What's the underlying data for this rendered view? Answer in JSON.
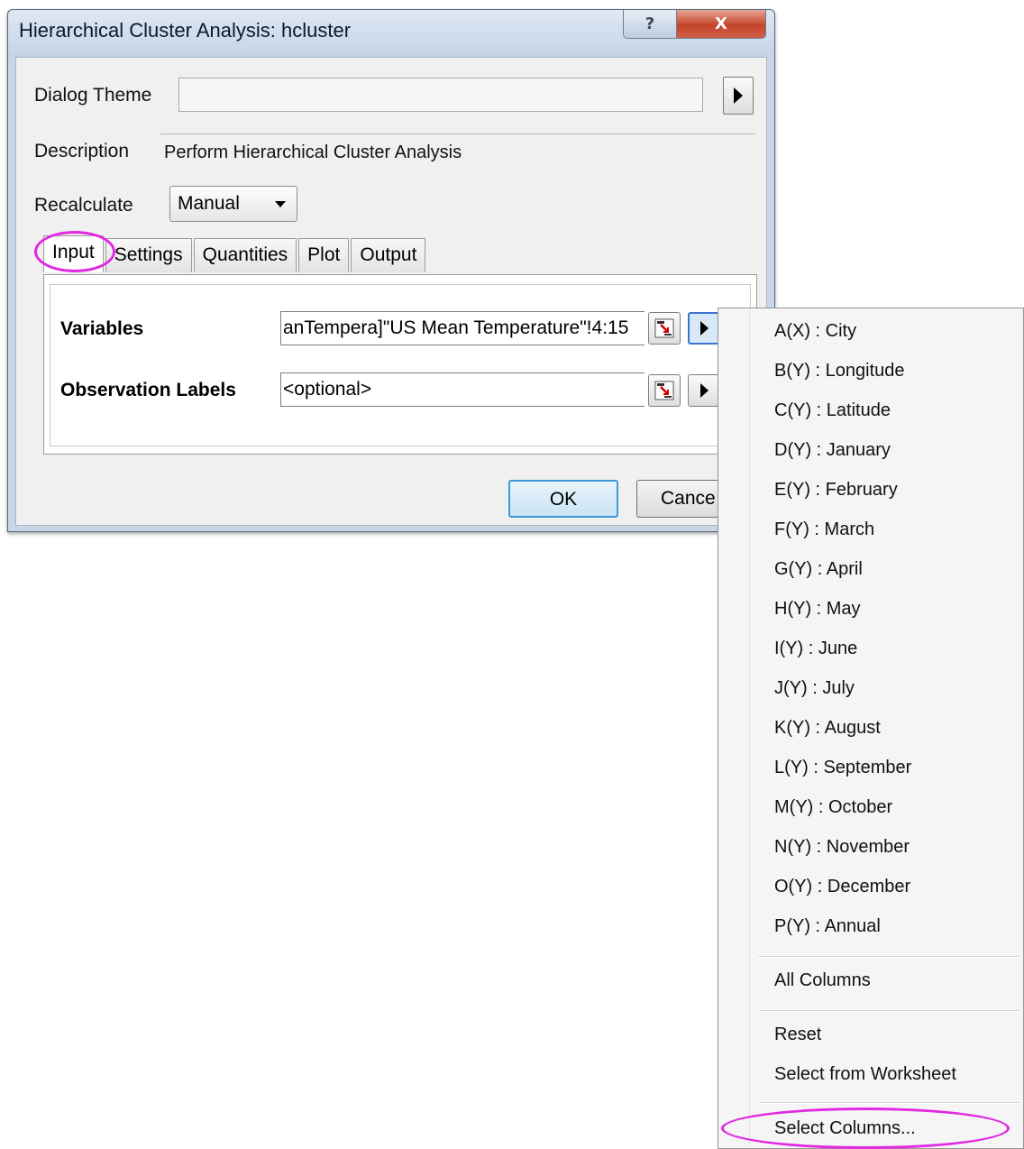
{
  "window": {
    "title": "Hierarchical Cluster Analysis: hcluster",
    "help_glyph": "?",
    "close_glyph": "X"
  },
  "form": {
    "dialog_theme_label": "Dialog Theme",
    "dialog_theme_value": "",
    "description_label": "Description",
    "description_value": "Perform Hierarchical Cluster Analysis",
    "recalculate_label": "Recalculate",
    "recalculate_value": "Manual"
  },
  "tabs": [
    "Input",
    "Settings",
    "Quantities",
    "Plot",
    "Output"
  ],
  "active_tab": "Input",
  "input": {
    "variables_label": "Variables",
    "variables_value": "anTempera]\"US Mean Temperature\"!4:15",
    "observation_labels_label": "Observation Labels",
    "observation_labels_value": "<optional>"
  },
  "buttons": {
    "ok": "OK",
    "cancel": "Cance"
  },
  "menu": {
    "columns": [
      "A(X) : City",
      "B(Y) : Longitude",
      "C(Y) : Latitude",
      "D(Y) : January",
      "E(Y) : February",
      "F(Y) : March",
      "G(Y) : April",
      "H(Y) : May",
      "I(Y) : June",
      "J(Y) : July",
      "K(Y) : August",
      "L(Y) : September",
      "M(Y) : October",
      "N(Y) : November",
      "O(Y) : December",
      "P(Y) : Annual"
    ],
    "all_columns": "All Columns",
    "reset": "Reset",
    "select_from_worksheet": "Select from Worksheet",
    "select_columns": "Select Columns..."
  },
  "colors": {
    "highlight_circle": "#e228e2",
    "focus_border": "#3a76c9"
  }
}
